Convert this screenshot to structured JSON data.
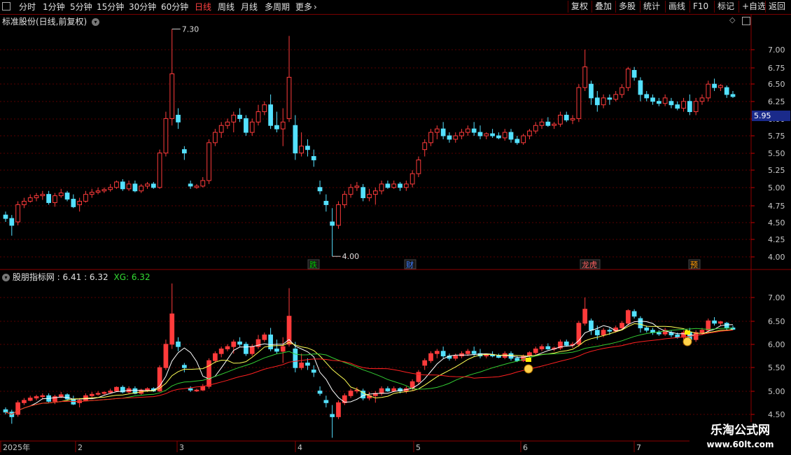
{
  "toolbar": {
    "window_icon": "window-menu-icon",
    "periods": [
      "分时",
      "1分钟",
      "5分钟",
      "15分钟",
      "30分钟",
      "60分钟",
      "日线",
      "周线",
      "月线",
      "多周期",
      "更多"
    ],
    "active_period": "日线",
    "more_arrow": "›",
    "right_buttons": [
      "复权",
      "叠加",
      "多股",
      "统计",
      "画线",
      "F10",
      "标记",
      "+自选",
      "返回"
    ]
  },
  "main_panel": {
    "title": "标准股份(日线,前复权)",
    "price_axis": [
      "7.00",
      "6.75",
      "6.50",
      "6.25",
      "6.00",
      "5.75",
      "5.50",
      "5.25",
      "5.00",
      "4.75",
      "4.50",
      "4.25",
      "4.00"
    ],
    "current_price": "5.95",
    "high_marker": "7.30",
    "low_marker": "4.00",
    "event_tags": [
      {
        "label": "跌",
        "color": "#00c000"
      },
      {
        "label": "财",
        "color": "#3a7bff"
      },
      {
        "label": "龙虎",
        "color": "#ff6060"
      },
      {
        "label": "预",
        "color": "#ff9900"
      }
    ]
  },
  "indicator_panel": {
    "name": "股朋指标网",
    "values_text": ": 6.41 : 6.32",
    "xg_label": "XG:",
    "xg_value": "6.32",
    "price_axis": [
      "7.00",
      "6.50",
      "6.00",
      "5.50",
      "5.00",
      "4.50"
    ]
  },
  "date_axis": {
    "labels": [
      "2025年",
      "2",
      "3",
      "4",
      "5",
      "6",
      "7"
    ]
  },
  "watermark": {
    "line1": "乐淘公式网",
    "line2": "www.60lt.com"
  },
  "colors": {
    "up": "#ff3b3b",
    "down": "#54e1ff",
    "grid": "#5a0000",
    "border": "#8b0000",
    "ma_white": "#ffffff",
    "ma_yellow": "#ffff55",
    "ma_green": "#33cc33",
    "ma_red": "#ff2020"
  }
}
